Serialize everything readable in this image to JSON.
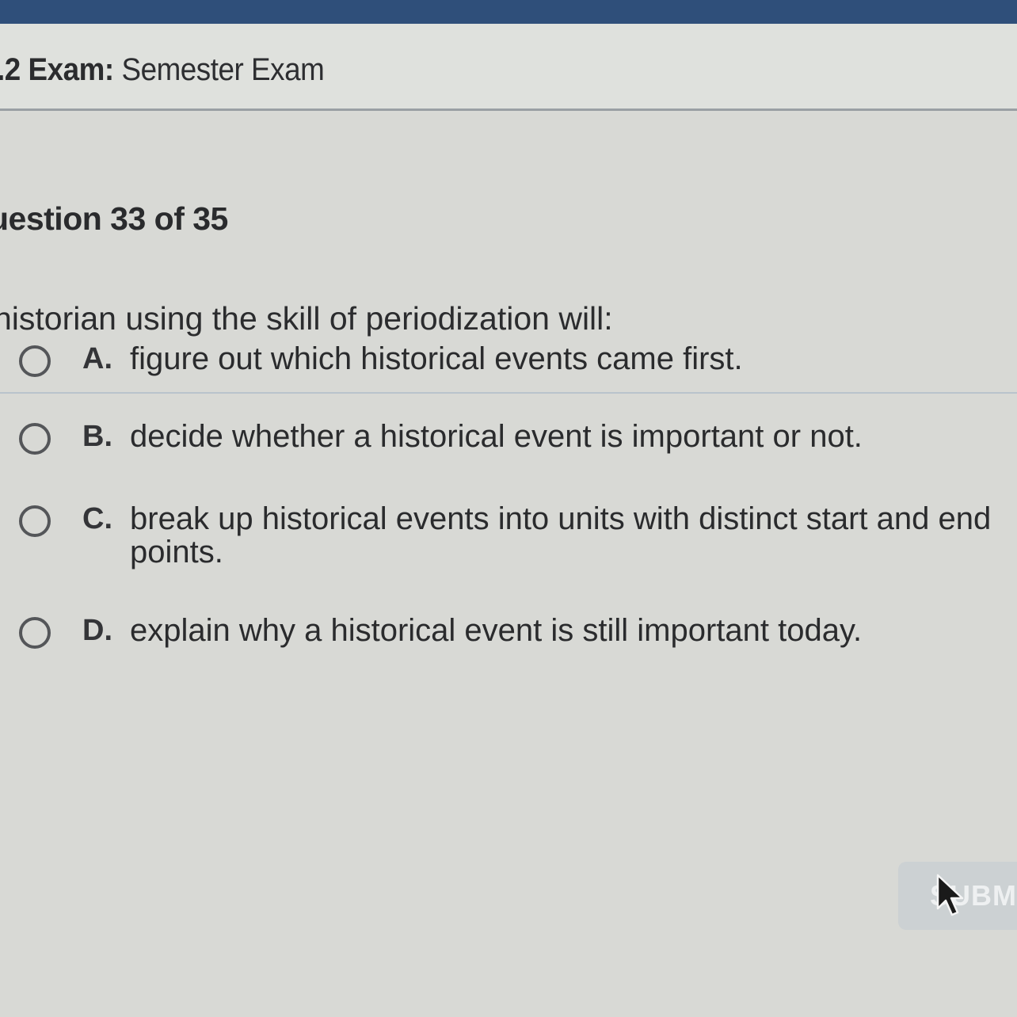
{
  "header": {
    "number": ".2",
    "label": "Exam:",
    "name": "Semester Exam"
  },
  "question": {
    "counter": "uestion 33 of 35",
    "text": "historian using the skill of periodization will:"
  },
  "choices": [
    {
      "letter": "A.",
      "text": "figure out which historical events came first."
    },
    {
      "letter": "B.",
      "text": "decide whether a historical event is important or not."
    },
    {
      "letter": "C.",
      "text": "break up historical events into units with distinct start and end points."
    },
    {
      "letter": "D.",
      "text": "explain why a historical event is still important today."
    }
  ],
  "submit": {
    "label": "SUBMI"
  },
  "colors": {
    "header_strip": "#2f4f7a",
    "background": "#d8d9d5",
    "submit_disabled": "#ccd1d3"
  }
}
